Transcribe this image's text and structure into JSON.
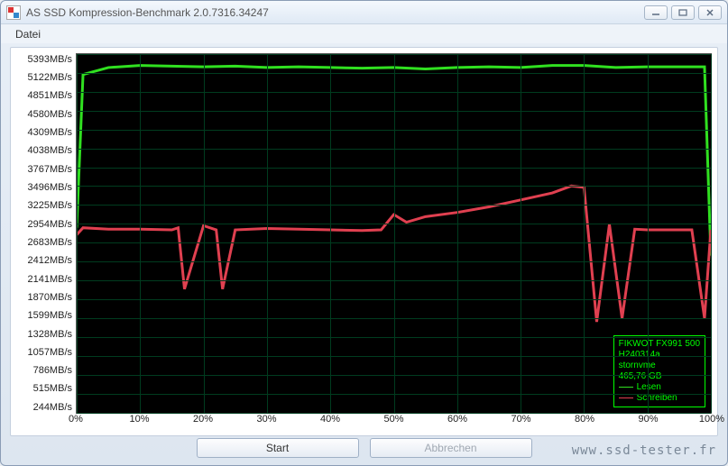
{
  "window": {
    "title": "AS SSD Kompression-Benchmark 2.0.7316.34247"
  },
  "menu": {
    "file": "Datei"
  },
  "buttons": {
    "start": "Start",
    "cancel": "Abbrechen"
  },
  "watermark": "www.ssd-tester.fr",
  "legend": {
    "device": "FIKWOT FX991 500",
    "model": "H240314a",
    "driver": "stornvme",
    "capacity": "465,76 GB",
    "read_label": "Lesen",
    "write_label": "Schreiben",
    "read_color": "#30e020",
    "write_color": "#e04050"
  },
  "chart_data": {
    "type": "line",
    "xlabel": "",
    "ylabel": "",
    "ylim": [
      0,
      5393
    ],
    "xlim": [
      0,
      100
    ],
    "y_ticks": [
      244,
      515,
      786,
      1057,
      1328,
      1599,
      1870,
      2141,
      2412,
      2683,
      2954,
      3225,
      3496,
      3767,
      4038,
      4309,
      4580,
      4851,
      5122,
      5393
    ],
    "y_unit": "MB/s",
    "x_ticks": [
      0,
      10,
      20,
      30,
      40,
      50,
      60,
      70,
      80,
      90,
      100
    ],
    "x_unit": "%",
    "series": [
      {
        "name": "Lesen",
        "color": "#30e020",
        "x": [
          0,
          1,
          5,
          10,
          15,
          20,
          25,
          30,
          35,
          40,
          45,
          50,
          55,
          60,
          65,
          70,
          75,
          80,
          85,
          90,
          95,
          99,
          100
        ],
        "values": [
          2900,
          5100,
          5200,
          5230,
          5220,
          5210,
          5220,
          5200,
          5210,
          5200,
          5190,
          5200,
          5180,
          5200,
          5210,
          5200,
          5230,
          5230,
          5200,
          5210,
          5210,
          5210,
          2500
        ]
      },
      {
        "name": "Schreiben",
        "color": "#e04050",
        "x": [
          0,
          1,
          5,
          10,
          15,
          16,
          17,
          20,
          22,
          23,
          25,
          30,
          35,
          40,
          45,
          48,
          50,
          52,
          55,
          60,
          65,
          70,
          75,
          78,
          80,
          82,
          84,
          86,
          88,
          90,
          95,
          97,
          99,
          100
        ],
        "values": [
          2800,
          2900,
          2880,
          2880,
          2870,
          2900,
          2020,
          2930,
          2870,
          2020,
          2870,
          2890,
          2880,
          2870,
          2860,
          2870,
          3090,
          2980,
          3060,
          3120,
          3200,
          3300,
          3400,
          3500,
          3480,
          1550,
          2950,
          1600,
          2880,
          2870,
          2870,
          2870,
          1600,
          2870
        ]
      }
    ]
  }
}
